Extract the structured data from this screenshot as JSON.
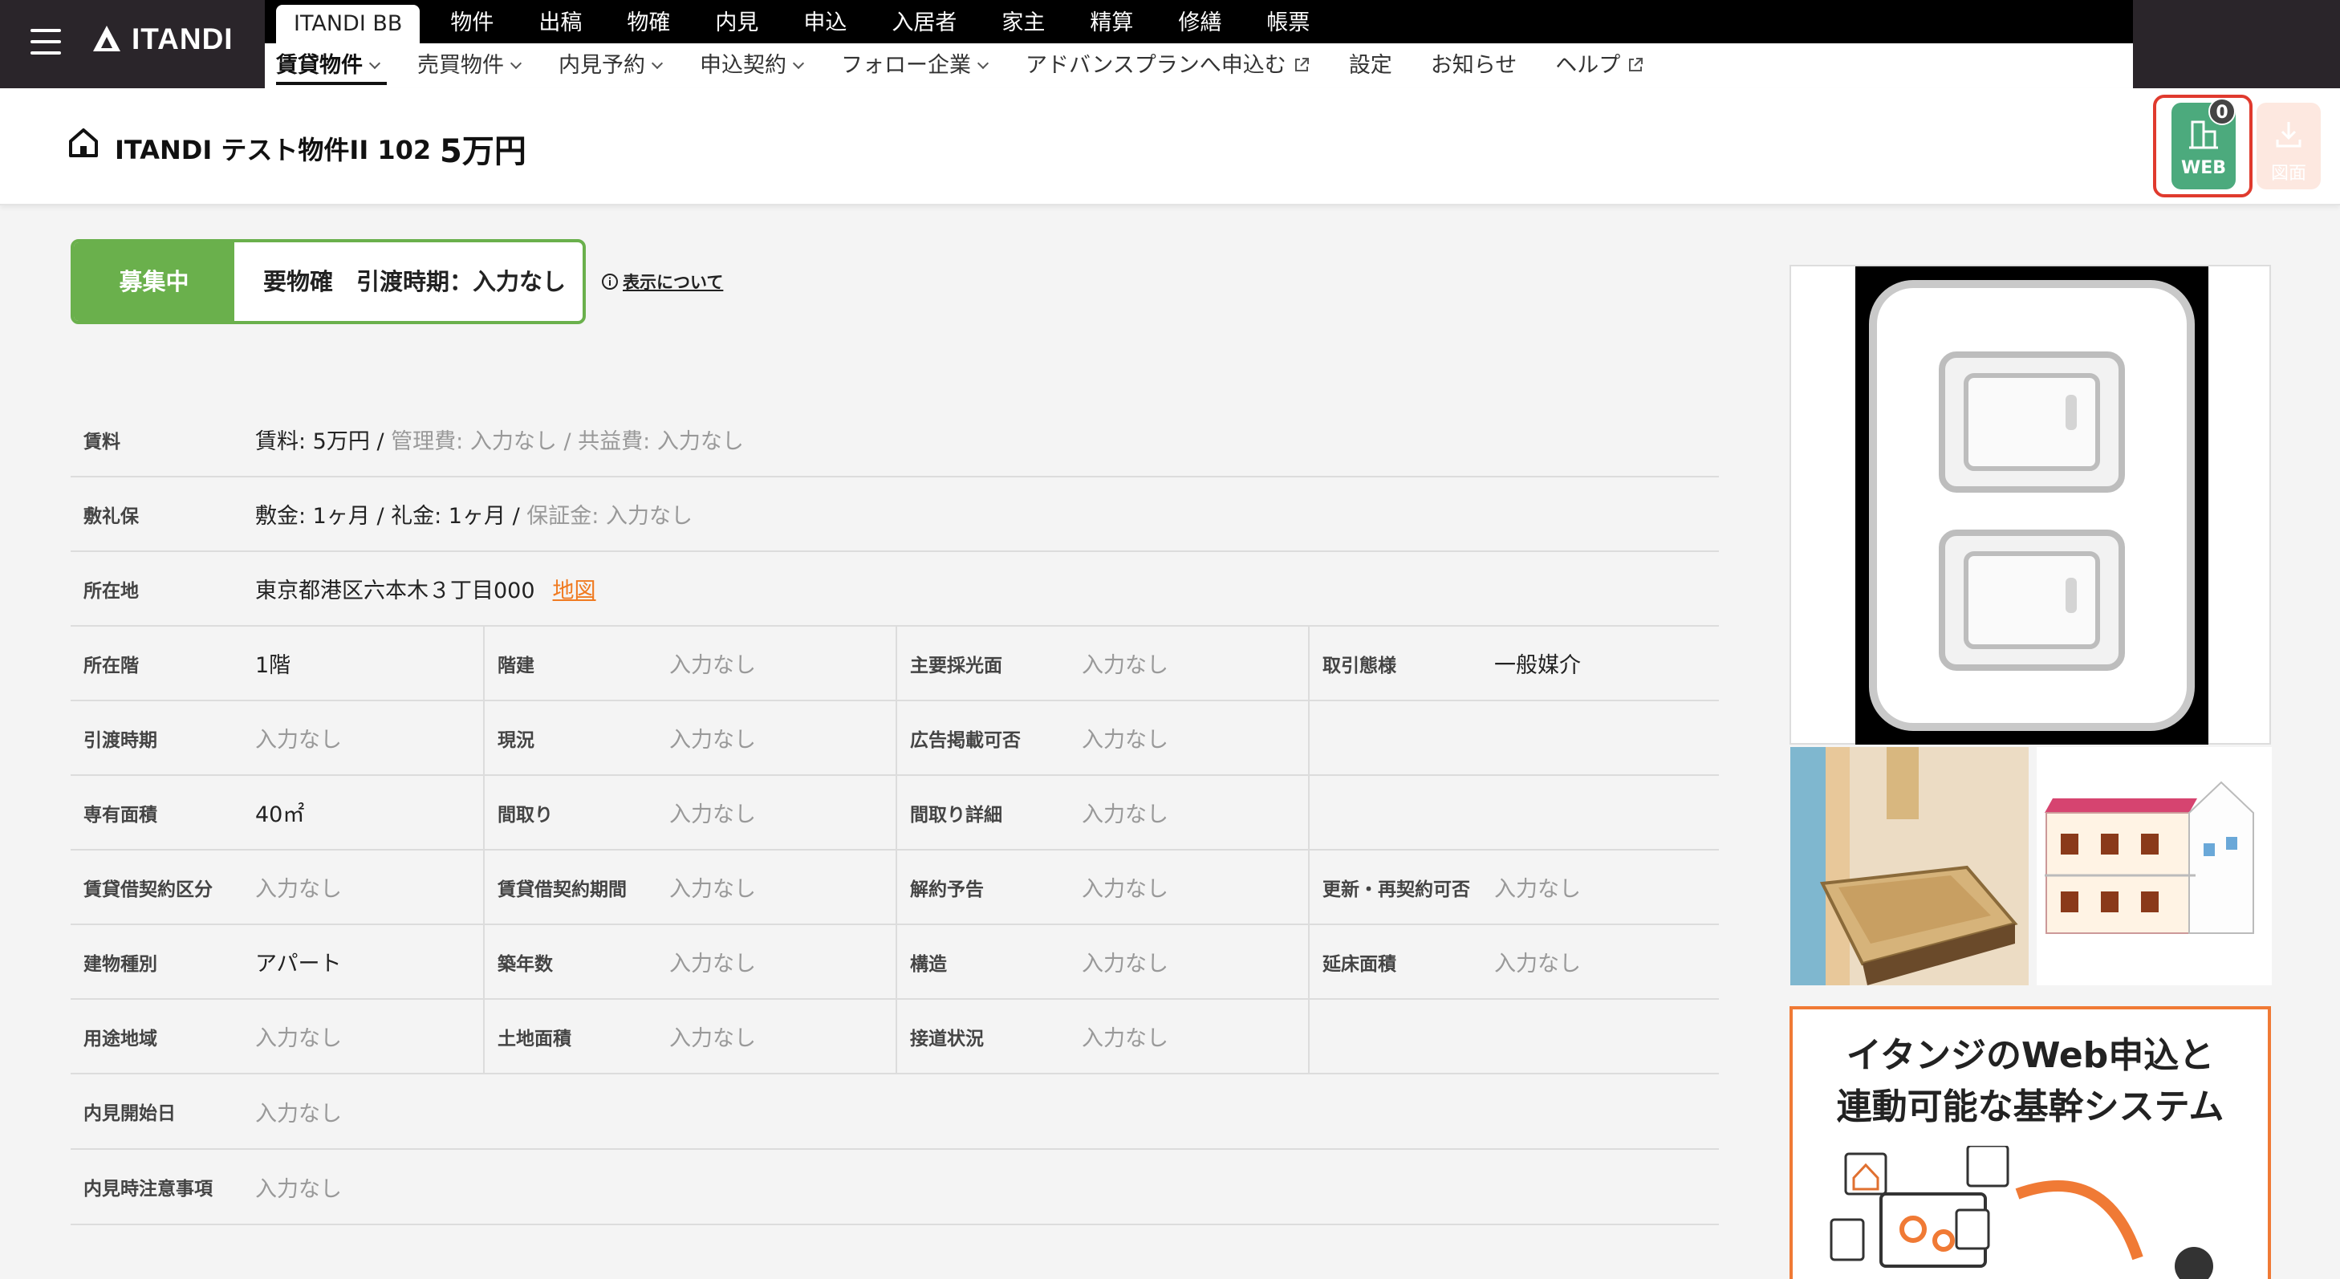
{
  "app": {
    "logo_text": "ITANDI"
  },
  "nav_top": {
    "tabs": [
      "ITANDI BB",
      "物件",
      "出稿",
      "物確",
      "内見",
      "申込",
      "入居者",
      "家主",
      "精算",
      "修繕",
      "帳票"
    ]
  },
  "nav_bottom": {
    "items": [
      {
        "label": "賃貸物件",
        "dropdown": true,
        "external": false
      },
      {
        "label": "売買物件",
        "dropdown": true,
        "external": false
      },
      {
        "label": "内見予約",
        "dropdown": true,
        "external": false
      },
      {
        "label": "申込契約",
        "dropdown": true,
        "external": false
      },
      {
        "label": "フォロー企業",
        "dropdown": true,
        "external": false
      },
      {
        "label": "アドバンスプランへ申込む",
        "dropdown": false,
        "external": true
      },
      {
        "label": "設定",
        "dropdown": false,
        "external": false
      },
      {
        "label": "お知らせ",
        "dropdown": false,
        "external": false
      },
      {
        "label": "ヘルプ",
        "dropdown": false,
        "external": true
      }
    ]
  },
  "property": {
    "name": "ITANDI テスト物件II 102",
    "rent": "5万円"
  },
  "actions": {
    "web_label": "WEB",
    "web_badge": "0",
    "zumen_label": "図面"
  },
  "status": {
    "label": "募集中",
    "text": "要物確　引渡時期：入力なし",
    "info_link": "表示について"
  },
  "details": {
    "rent_label": "賃料",
    "rent_value": "賃料: 5万円",
    "rent_mgmt": "管理費: 入力なし",
    "rent_common": "共益費: 入力なし",
    "deposit_label": "敷礼保",
    "deposit_value": "敷金: 1ヶ月 / 礼金: 1ヶ月",
    "deposit_guarantee": "保証金: 入力なし",
    "address_label": "所在地",
    "address_value": "東京都港区六本木３丁目000",
    "map_link": "地図",
    "sep": "/",
    "grid": [
      [
        {
          "label": "所在階",
          "value": "1階",
          "empty": false
        },
        {
          "label": "階建",
          "value": "入力なし",
          "empty": true
        },
        {
          "label": "主要採光面",
          "value": "入力なし",
          "empty": true
        },
        {
          "label": "取引態様",
          "value": "一般媒介",
          "empty": false
        }
      ],
      [
        {
          "label": "引渡時期",
          "value": "入力なし",
          "empty": true
        },
        {
          "label": "現況",
          "value": "入力なし",
          "empty": true
        },
        {
          "label": "広告掲載可否",
          "value": "入力なし",
          "empty": true
        },
        {
          "label": "",
          "value": "",
          "empty": true
        }
      ],
      [
        {
          "label": "専有面積",
          "value": "40㎡",
          "empty": false
        },
        {
          "label": "間取り",
          "value": "入力なし",
          "empty": true
        },
        {
          "label": "間取り詳細",
          "value": "入力なし",
          "empty": true
        },
        {
          "label": "",
          "value": "",
          "empty": true
        }
      ],
      [
        {
          "label": "賃貸借契約区分",
          "value": "入力なし",
          "empty": true
        },
        {
          "label": "賃貸借契約期間",
          "value": "入力なし",
          "empty": true
        },
        {
          "label": "解約予告",
          "value": "入力なし",
          "empty": true
        },
        {
          "label": "更新・再契約可否",
          "value": "入力なし",
          "empty": true
        }
      ],
      [
        {
          "label": "建物種別",
          "value": "アパート",
          "empty": false
        },
        {
          "label": "築年数",
          "value": "入力なし",
          "empty": true
        },
        {
          "label": "構造",
          "value": "入力なし",
          "empty": true
        },
        {
          "label": "延床面積",
          "value": "入力なし",
          "empty": true
        }
      ],
      [
        {
          "label": "用途地域",
          "value": "入力なし",
          "empty": true
        },
        {
          "label": "土地面積",
          "value": "入力なし",
          "empty": true
        },
        {
          "label": "接道状況",
          "value": "入力なし",
          "empty": true
        },
        {
          "label": "",
          "value": "",
          "empty": true
        }
      ]
    ],
    "naiken_start_label": "内見開始日",
    "naiken_start_value": "入力なし",
    "naiken_note_label": "内見時注意事項",
    "naiken_note_value": "入力なし"
  },
  "ad": {
    "title_line1": "イタンジのWeb申込と",
    "title_line2": "連動可能な基幹システム"
  },
  "colors": {
    "nav_bg": "#2a252a",
    "status_green": "#6ab04c",
    "web_green": "#4caa7d",
    "highlight_red": "#e03a2e",
    "link_orange": "#f07a20"
  },
  "icons": {
    "menu": "hamburger-icon",
    "logo": "itandi-logo-icon",
    "home": "home-icon",
    "web": "building-icon",
    "zumen": "download-icon",
    "info": "info-icon",
    "external": "external-link-icon"
  }
}
